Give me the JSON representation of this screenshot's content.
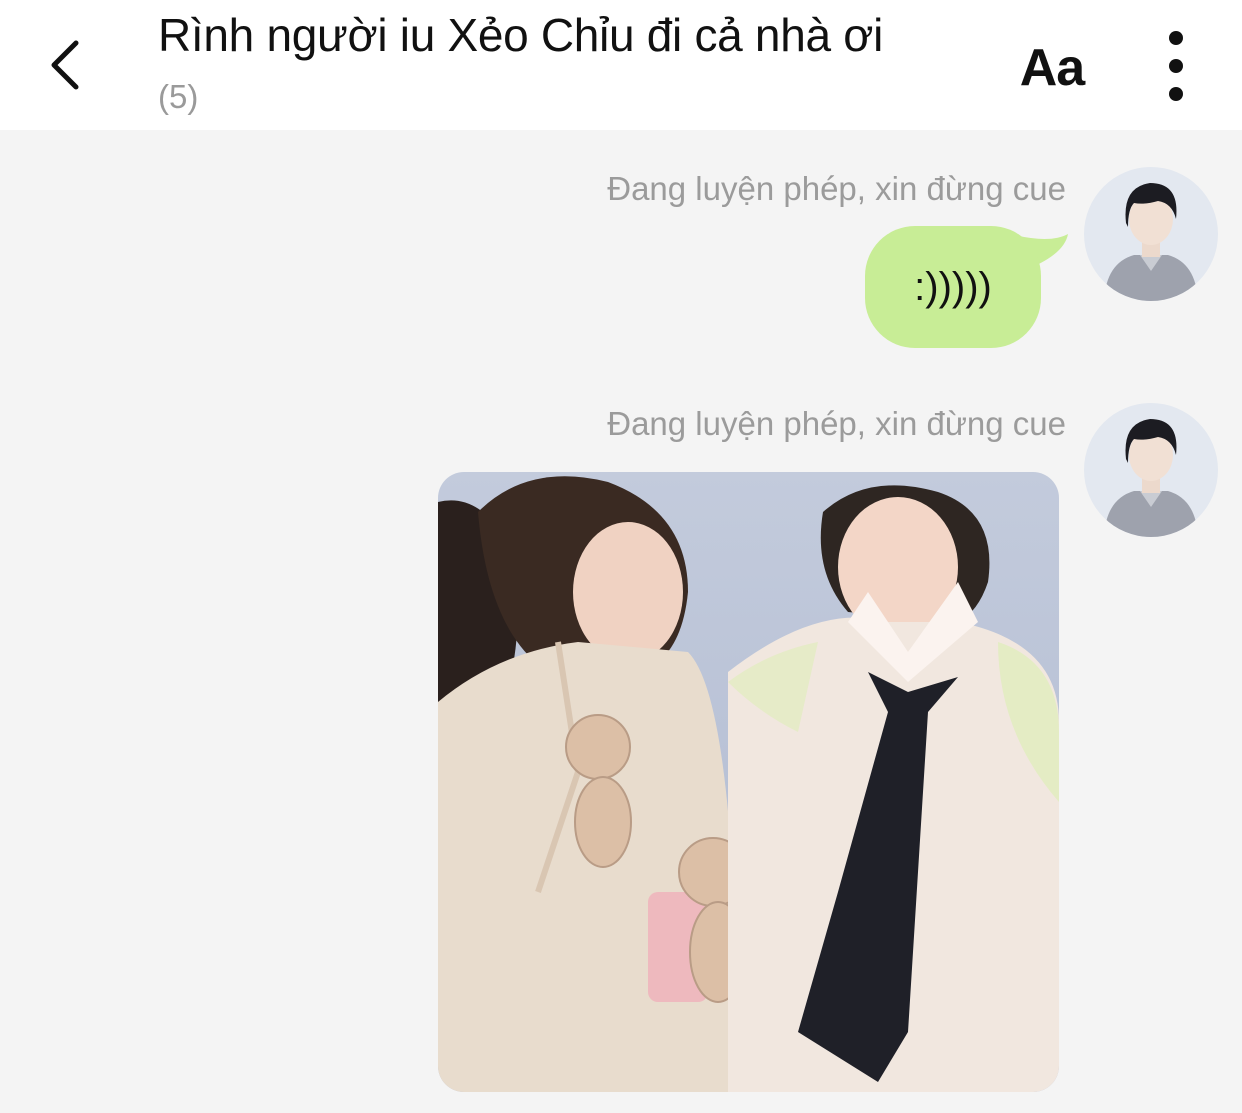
{
  "header": {
    "title": "Rình người iu Xẻo Chỉu đi cả nhà ơi",
    "member_count": "(5)",
    "font_button_label": "Aa",
    "back_icon": "chevron-left-icon",
    "more_icon": "vertical-dots-icon"
  },
  "messages": [
    {
      "sender": "Đang luyện phép, xin đừng cue",
      "type": "text",
      "text": ":)))))"
    },
    {
      "sender": "Đang luyện phép, xin đừng cue",
      "type": "image"
    }
  ],
  "colors": {
    "header_bg": "#ffffff",
    "chat_bg": "#f4f4f4",
    "outgoing_bubble": "#c8ed96",
    "sender_text": "#9b9b9b"
  }
}
